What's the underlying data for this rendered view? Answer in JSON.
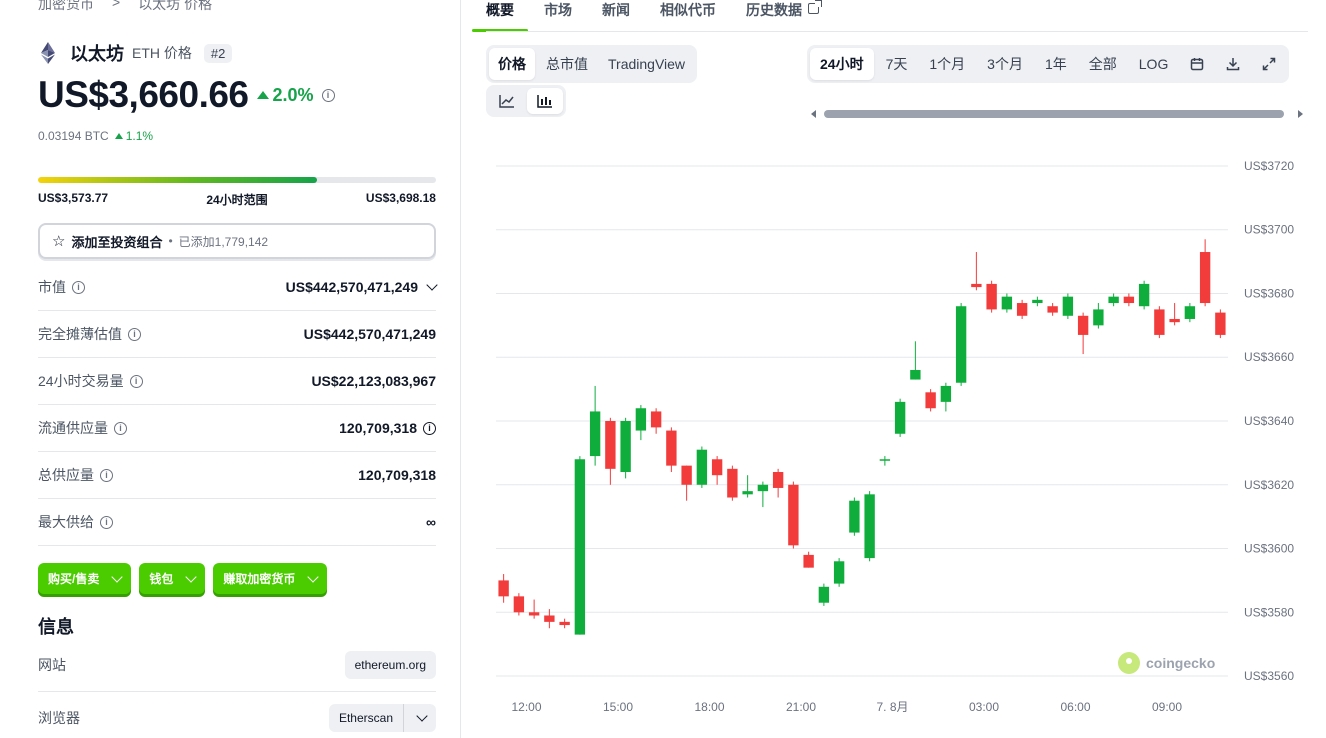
{
  "breadcrumb": {
    "parent": "加密货币",
    "sep": ">",
    "current": "以太坊 价格"
  },
  "coin": {
    "name": "以太坊",
    "symbol_label": "ETH 价格",
    "rank": "#2",
    "price": "US$3,660.66",
    "change_24h": "2.0%",
    "btc_price": "0.03194 BTC",
    "btc_change": "1.1%"
  },
  "range": {
    "low": "US$3,573.77",
    "label": "24小时范围",
    "high": "US$3,698.18",
    "fill_fraction": 0.7
  },
  "portfolio": {
    "label": "添加至投资组合",
    "dot": "•",
    "added": "已添加1,779,142"
  },
  "stats": [
    {
      "label": "市值",
      "value": "US$442,570,471,249"
    },
    {
      "label": "完全摊薄估值",
      "value": "US$442,570,471,249"
    },
    {
      "label": "24小时交易量",
      "value": "US$22,123,083,967"
    },
    {
      "label": "流通供应量",
      "value": "120,709,318"
    },
    {
      "label": "总供应量",
      "value": "120,709,318"
    },
    {
      "label": "最大供给",
      "value": "∞"
    }
  ],
  "actions": {
    "buy_sell": "购买/售卖",
    "wallet": "钱包",
    "earn": "赚取加密货币"
  },
  "info": {
    "title": "信息",
    "website_label": "网站",
    "website_value": "ethereum.org",
    "explorer_label": "浏览器",
    "explorer_value": "Etherscan"
  },
  "tabs": [
    "概要",
    "市场",
    "新闻",
    "相似代币",
    "历史数据"
  ],
  "chart_mode": [
    "价格",
    "总市值",
    "TradingView"
  ],
  "time_ranges": [
    "24小时",
    "7天",
    "1个月",
    "3个月",
    "1年",
    "全部",
    "LOG"
  ],
  "watermark": "coingecko",
  "colors": {
    "up": "#16a34a",
    "candle_up": "#0fae3c",
    "candle_down": "#f23b3b",
    "accent": "#4bcc00"
  },
  "chart_data": {
    "type": "candlestick",
    "ylim": [
      3555,
      3725
    ],
    "y_ticks": [
      3560,
      3580,
      3600,
      3620,
      3640,
      3660,
      3680,
      3700,
      3720
    ],
    "y_tick_labels": [
      "US$3560",
      "US$3580",
      "US$3600",
      "US$3620",
      "US$3640",
      "US$3660",
      "US$3680",
      "US$3700",
      "US$3720"
    ],
    "x_labels": [
      "12:00",
      "15:00",
      "18:00",
      "21:00",
      "7. 8月",
      "03:00",
      "06:00",
      "09:00"
    ],
    "x_label_index": [
      1.5,
      7.5,
      13.5,
      19.5,
      25.5,
      31.5,
      37.5,
      43.5
    ],
    "candles": [
      [
        3590,
        3585,
        3592,
        3583
      ],
      [
        3585,
        3580,
        3586,
        3579
      ],
      [
        3580,
        3579,
        3584,
        3578
      ],
      [
        3579,
        3577,
        3581,
        3575
      ],
      [
        3577,
        3576,
        3578,
        3575
      ],
      [
        3573,
        3628,
        3629,
        3573
      ],
      [
        3629,
        3643,
        3651,
        3626
      ],
      [
        3640,
        3625,
        3641,
        3620
      ],
      [
        3624,
        3640,
        3641,
        3622
      ],
      [
        3637,
        3644,
        3645,
        3634
      ],
      [
        3643,
        3638,
        3644,
        3636
      ],
      [
        3637,
        3626,
        3638,
        3624
      ],
      [
        3626,
        3620,
        3626,
        3615
      ],
      [
        3620,
        3631,
        3632,
        3619
      ],
      [
        3628,
        3623,
        3629,
        3620
      ],
      [
        3625,
        3616,
        3626,
        3615
      ],
      [
        3617,
        3618,
        3623,
        3616
      ],
      [
        3618,
        3620,
        3621,
        3613
      ],
      [
        3624,
        3619,
        3625,
        3616
      ],
      [
        3620,
        3601,
        3621,
        3600
      ],
      [
        3598,
        3594,
        3599,
        3594
      ],
      [
        3583,
        3588,
        3589,
        3582
      ],
      [
        3589,
        3596,
        3597,
        3588
      ],
      [
        3605,
        3615,
        3616,
        3604
      ],
      [
        3597,
        3617,
        3618,
        3596
      ],
      [
        3628,
        3628,
        3629,
        3626
      ],
      [
        3636,
        3646,
        3647,
        3635
      ],
      [
        3653,
        3656,
        3665,
        3653
      ],
      [
        3649,
        3644,
        3650,
        3643
      ],
      [
        3646,
        3651,
        3652,
        3643
      ],
      [
        3652,
        3676,
        3677,
        3651
      ],
      [
        3683,
        3682,
        3693,
        3681
      ],
      [
        3683,
        3675,
        3684,
        3674
      ],
      [
        3675,
        3679,
        3680,
        3674
      ],
      [
        3677,
        3673,
        3678,
        3672
      ],
      [
        3677,
        3678,
        3679,
        3676
      ],
      [
        3676,
        3674,
        3677,
        3673
      ],
      [
        3673,
        3679,
        3680,
        3672
      ],
      [
        3673,
        3667,
        3674,
        3661
      ],
      [
        3670,
        3675,
        3677,
        3669
      ],
      [
        3677,
        3679,
        3680,
        3676
      ],
      [
        3679,
        3677,
        3680,
        3676
      ],
      [
        3676,
        3683,
        3684,
        3675
      ],
      [
        3675,
        3667,
        3676,
        3666
      ],
      [
        3672,
        3671,
        3677,
        3670
      ],
      [
        3672,
        3676,
        3677,
        3671
      ],
      [
        3693,
        3677,
        3697,
        3676
      ],
      [
        3674,
        3667,
        3675,
        3666
      ]
    ]
  }
}
